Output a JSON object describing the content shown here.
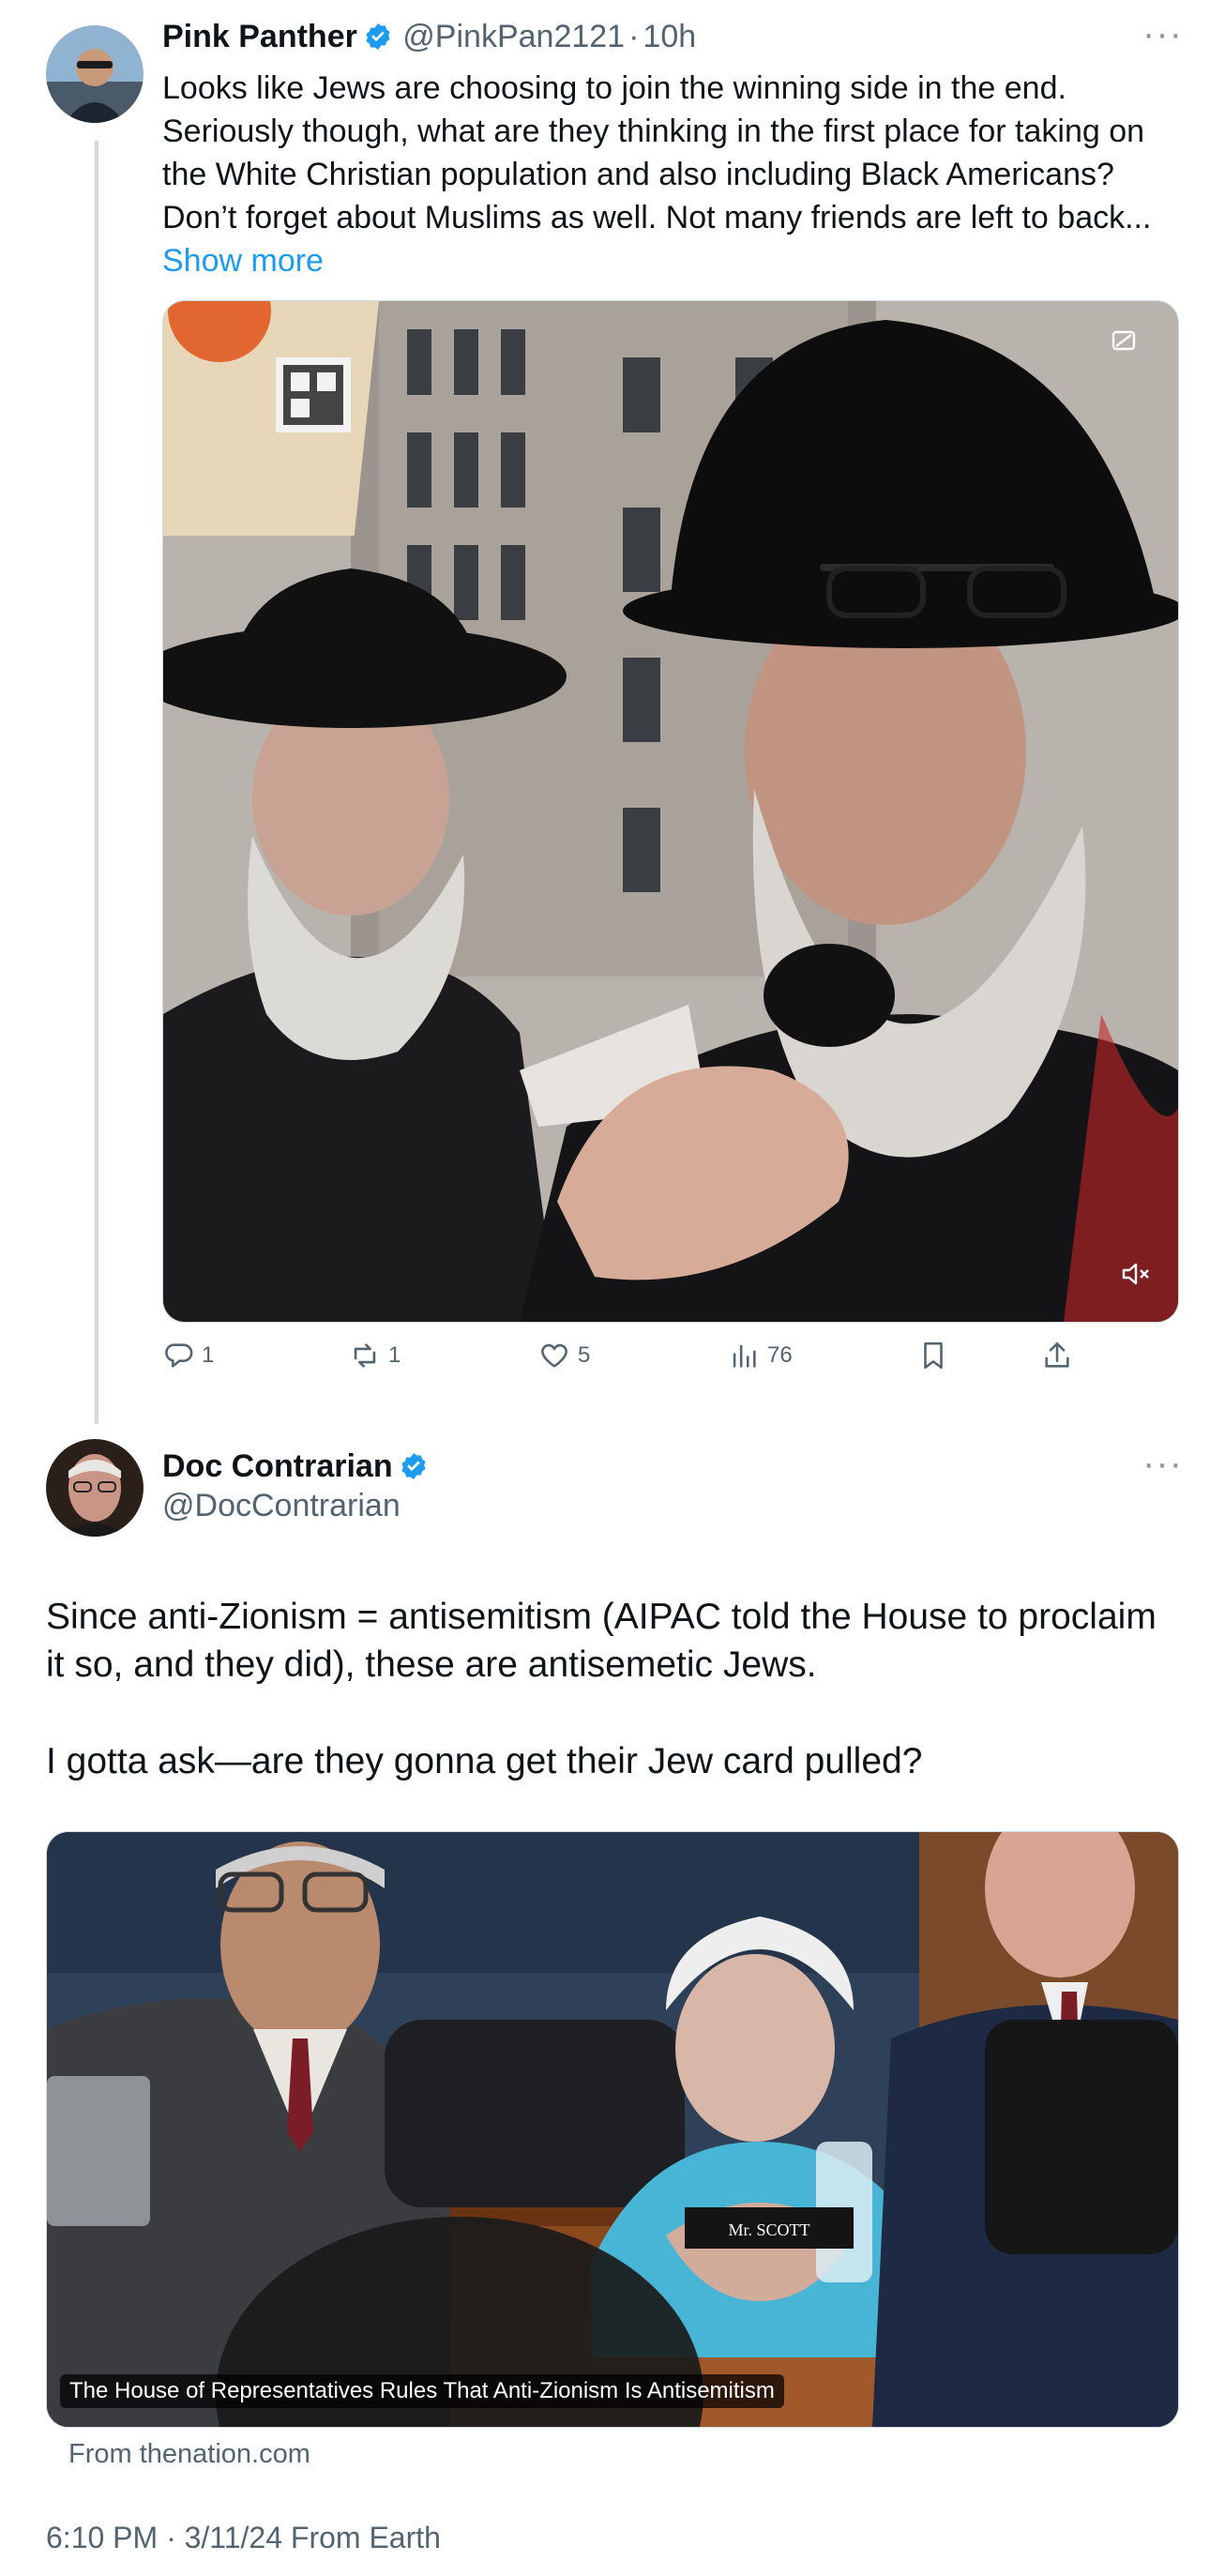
{
  "reply_tweet": {
    "display_name": "Pink Panther",
    "handle": "@PinkPan2121",
    "separator": "·",
    "time_ago": "10h",
    "text": "Looks like Jews are choosing to join the winning side in the end. Seriously though, what are they thinking in the first place for taking on the White Christian population and also including Black Americans? Don’t forget about Muslims as well. Not many friends are left to back...",
    "show_more": "Show more",
    "actions": {
      "replies": "1",
      "reposts": "1",
      "likes": "5",
      "views": "76"
    }
  },
  "main_tweet": {
    "display_name": "Doc Contrarian",
    "handle": "@DocContrarian",
    "paragraph1": "Since anti-Zionism = antisemitism (AIPAC told the House to proclaim it so, and they did), these are antisemetic Jews.",
    "paragraph2": "I gotta ask—are they gonna get their Jew card pulled?",
    "card_headline": "The House of Representatives Rules That Anti-Zionism Is Antisemitism",
    "card_source": "From thenation.com",
    "timestamp": "6:10 PM · 3/11/24 From Earth",
    "name_plate": "Mr. SCOTT"
  },
  "colors": {
    "accent": "#1d9bf0",
    "secondary_text": "#536471",
    "text": "#0f1419"
  },
  "icons": [
    "verified-badge-icon",
    "more-options-icon",
    "reply-icon",
    "repost-icon",
    "like-icon",
    "views-icon",
    "bookmark-icon",
    "share-icon",
    "mute-icon",
    "gif-icon"
  ]
}
